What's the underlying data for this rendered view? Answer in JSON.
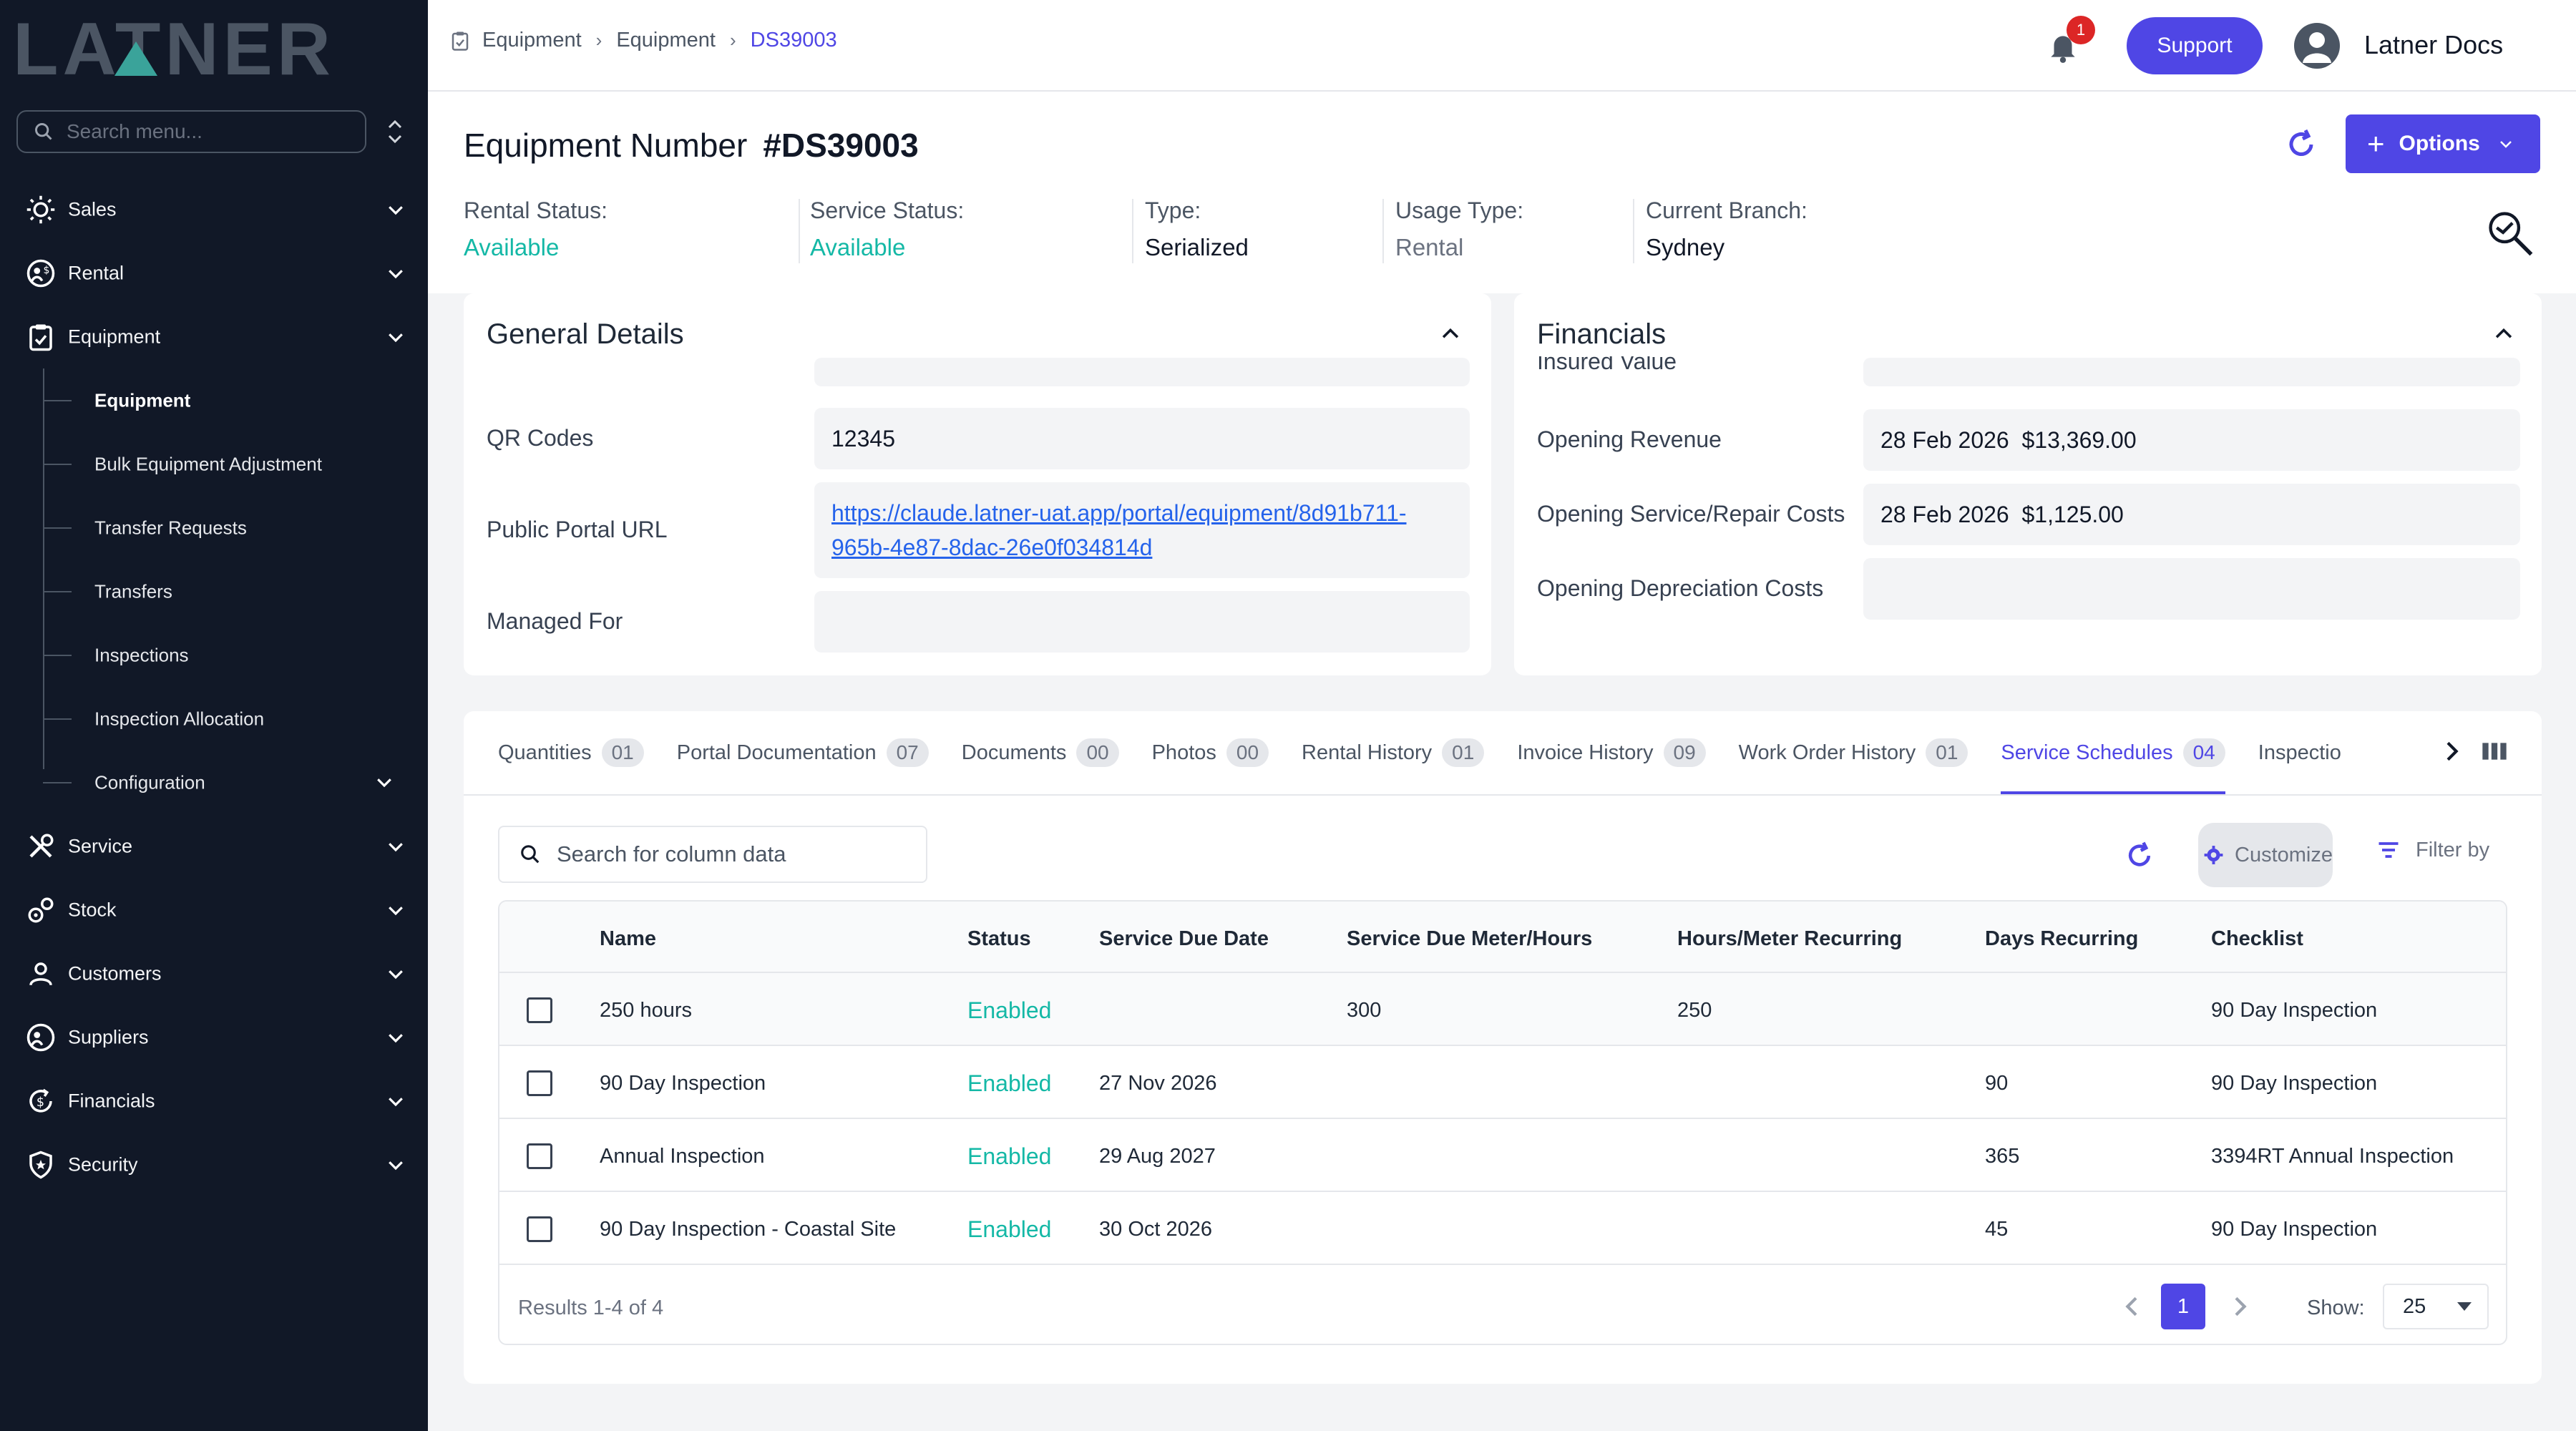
{
  "app": {
    "logo_text": "LATNER"
  },
  "sidebar": {
    "search_placeholder": "Search menu...",
    "items": [
      {
        "label": "Sales",
        "icon": "sales-icon"
      },
      {
        "label": "Rental",
        "icon": "rental-icon"
      },
      {
        "label": "Equipment",
        "icon": "clipboard-icon"
      },
      {
        "label": "Service",
        "icon": "tools-icon"
      },
      {
        "label": "Stock",
        "icon": "stock-icon"
      },
      {
        "label": "Customers",
        "icon": "user-icon"
      },
      {
        "label": "Suppliers",
        "icon": "suppliers-icon"
      },
      {
        "label": "Financials",
        "icon": "financials-icon"
      },
      {
        "label": "Security",
        "icon": "shield-icon"
      }
    ],
    "equipment_sub": [
      {
        "label": "Equipment",
        "active": true
      },
      {
        "label": "Bulk Equipment Adjustment"
      },
      {
        "label": "Transfer Requests"
      },
      {
        "label": "Transfers"
      },
      {
        "label": "Inspections"
      },
      {
        "label": "Inspection Allocation"
      },
      {
        "label": "Configuration"
      }
    ]
  },
  "topbar": {
    "breadcrumb": [
      "Equipment",
      "Equipment",
      "DS39003"
    ],
    "notification_count": "1",
    "support_label": "Support",
    "user_name": "Latner Docs"
  },
  "header": {
    "title_label": "Equipment Number",
    "title_value": "#DS39003",
    "options_label": "Options",
    "statuses": [
      {
        "label": "Rental Status:",
        "value": "Available",
        "style": "green"
      },
      {
        "label": "Service Status:",
        "value": "Available",
        "style": "green"
      },
      {
        "label": "Type:",
        "value": "Serialized",
        "style": "dark"
      },
      {
        "label": "Usage Type:",
        "value": "Rental",
        "style": "muted"
      },
      {
        "label": "Current Branch:",
        "value": "Sydney",
        "style": "dark"
      }
    ]
  },
  "general_details": {
    "title": "General Details",
    "qr_label": "QR Codes",
    "qr_value": "12345",
    "portal_label": "Public Portal URL",
    "portal_line1": "https://claude.latner-uat.app/portal/equipment/8d91b711-",
    "portal_line2": "965b-4e87-8dac-26e0f034814d",
    "managed_label": "Managed For",
    "managed_value": ""
  },
  "financials": {
    "title": "Financials",
    "partial_label": "Insured Value",
    "opening_revenue_label": "Opening Revenue",
    "opening_revenue_value": "28 Feb 2026  $13,369.00",
    "opening_service_label": "Opening Service/Repair Costs",
    "opening_service_value": "28 Feb 2026  $1,125.00",
    "opening_depr_label": "Opening Depreciation Costs",
    "opening_depr_value": ""
  },
  "tabs": [
    {
      "label": "Quantities",
      "count": "01"
    },
    {
      "label": "Portal Documentation",
      "count": "07"
    },
    {
      "label": "Documents",
      "count": "00"
    },
    {
      "label": "Photos",
      "count": "00"
    },
    {
      "label": "Rental History",
      "count": "01"
    },
    {
      "label": "Invoice History",
      "count": "09"
    },
    {
      "label": "Work Order History",
      "count": "01"
    },
    {
      "label": "Service Schedules",
      "count": "04",
      "active": true
    },
    {
      "label": "Inspectio",
      "count": ""
    }
  ],
  "table": {
    "search_placeholder": "Search for column data",
    "customize_label": "Customize",
    "filter_label": "Filter by",
    "columns": [
      "Name",
      "Status",
      "Service Due Date",
      "Service Due Meter/Hours",
      "Hours/Meter Recurring",
      "Days Recurring",
      "Checklist"
    ],
    "rows": [
      {
        "name": "250 hours",
        "status": "Enabled",
        "due_date": "",
        "due_meter": "300",
        "meter_recurring": "250",
        "days_recurring": "",
        "checklist": "90 Day Inspection"
      },
      {
        "name": "90 Day Inspection",
        "status": "Enabled",
        "due_date": "27 Nov 2026",
        "due_meter": "",
        "meter_recurring": "",
        "days_recurring": "90",
        "checklist": "90 Day Inspection"
      },
      {
        "name": "Annual Inspection",
        "status": "Enabled",
        "due_date": "29 Aug 2027",
        "due_meter": "",
        "meter_recurring": "",
        "days_recurring": "365",
        "checklist": "3394RT Annual Inspection"
      },
      {
        "name": "90 Day Inspection - Coastal Site",
        "status": "Enabled",
        "due_date": "30 Oct 2026",
        "due_meter": "",
        "meter_recurring": "",
        "days_recurring": "45",
        "checklist": "90 Day Inspection"
      }
    ],
    "results_text": "Results 1-4 of 4",
    "current_page": "1",
    "show_label": "Show:",
    "page_size": "25"
  },
  "colors": {
    "accent": "#4f46e5",
    "sidebar_bg": "#111827",
    "status_green": "#14b8a6",
    "logo_teal": "#3aa39a"
  }
}
